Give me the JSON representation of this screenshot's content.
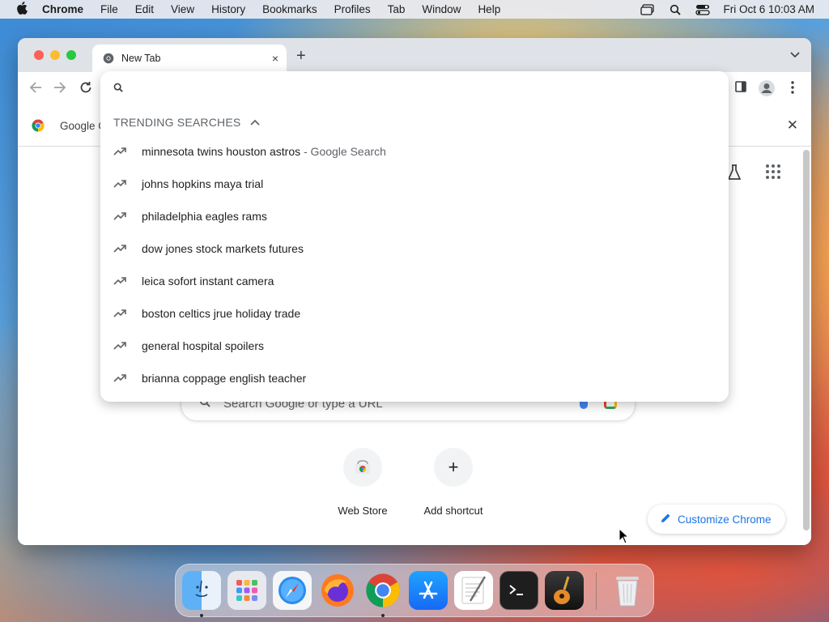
{
  "menubar": {
    "apple": "",
    "app_name": "Chrome",
    "items": [
      "File",
      "Edit",
      "View",
      "History",
      "Bookmarks",
      "Profiles",
      "Tab",
      "Window",
      "Help"
    ],
    "clock": "Fri Oct 6  10:03 AM"
  },
  "browser": {
    "tab_title": "New Tab",
    "tab_close": "×",
    "new_tab": "+",
    "tab_search": "⌄",
    "bookmark_text": "Google C",
    "bookmark_close": "✕"
  },
  "omnibox": {
    "value": "",
    "trending_header": "TRENDING SEARCHES",
    "suggestions": [
      {
        "text": "minnesota twins houston astros",
        "suffix": " - Google Search"
      },
      {
        "text": "johns hopkins maya trial",
        "suffix": ""
      },
      {
        "text": "philadelphia eagles rams",
        "suffix": ""
      },
      {
        "text": "dow jones stock markets futures",
        "suffix": ""
      },
      {
        "text": "leica sofort instant camera",
        "suffix": ""
      },
      {
        "text": "boston celtics jrue holiday trade",
        "suffix": ""
      },
      {
        "text": "general hospital spoilers",
        "suffix": ""
      },
      {
        "text": "brianna coppage english teacher",
        "suffix": ""
      }
    ]
  },
  "ntp": {
    "search_placeholder": "Search Google or type a URL",
    "shortcuts": [
      {
        "label": "Web Store"
      },
      {
        "label": "Add shortcut",
        "icon": "+"
      }
    ],
    "customize_label": "Customize Chrome"
  },
  "dock": {
    "apps": [
      "Finder",
      "Launchpad",
      "Safari",
      "Firefox",
      "Chrome",
      "App Store",
      "TextEdit",
      "Terminal",
      "GarageBand",
      "Trash"
    ]
  },
  "colors": {
    "accent": "#1a73e8",
    "tabstrip": "#dfe3e8"
  }
}
